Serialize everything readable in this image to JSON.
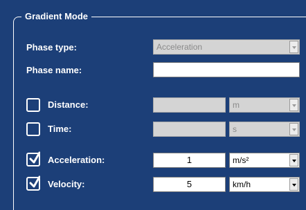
{
  "group": {
    "title": "Gradient Mode"
  },
  "phase_type": {
    "label": "Phase type:",
    "value": "Acceleration"
  },
  "phase_name": {
    "label": "Phase name:",
    "value": ""
  },
  "distance": {
    "label": "Distance:",
    "checked": false,
    "value": "",
    "unit": "m"
  },
  "time": {
    "label": "Time:",
    "checked": false,
    "value": "",
    "unit": "s"
  },
  "acceleration": {
    "label": "Acceleration:",
    "checked": true,
    "value": "1",
    "unit": "m/s²"
  },
  "velocity": {
    "label": "Velocity:",
    "checked": true,
    "value": "5",
    "unit": "km/h"
  }
}
